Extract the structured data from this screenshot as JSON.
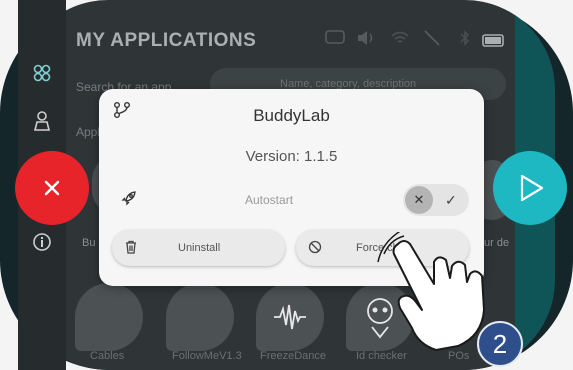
{
  "header": {
    "title": "MY APPLICATIONS"
  },
  "search": {
    "label": "Search for an app",
    "placeholder": "Name, category, description"
  },
  "apps_section_label": "Appl",
  "background_apps": [
    {
      "name": "Cables"
    },
    {
      "name": "FollowMeV1.3"
    },
    {
      "name": "FreezeDance"
    },
    {
      "name": "Id checker"
    },
    {
      "name": "POs"
    }
  ],
  "background_side_texts": {
    "left": "Bu",
    "right": "ur de"
  },
  "dialog": {
    "title": "BuddyLab",
    "version": "Version: 1.1.5",
    "autostart_label": "Autostart",
    "uninstall_label": "Uninstall",
    "force_close_label": "Force close",
    "icons": {
      "app": "branch-icon",
      "autostart": "rocket-icon",
      "uninstall": "trash-icon",
      "force_close": "block-icon"
    }
  },
  "side_buttons": {
    "close": "close-icon",
    "launch": "play-icon"
  },
  "step_badge": "2",
  "colors": {
    "close": "#e8242b",
    "launch": "#1eb8c2",
    "badge": "#2e4f8c",
    "screen": "#2f3537"
  }
}
